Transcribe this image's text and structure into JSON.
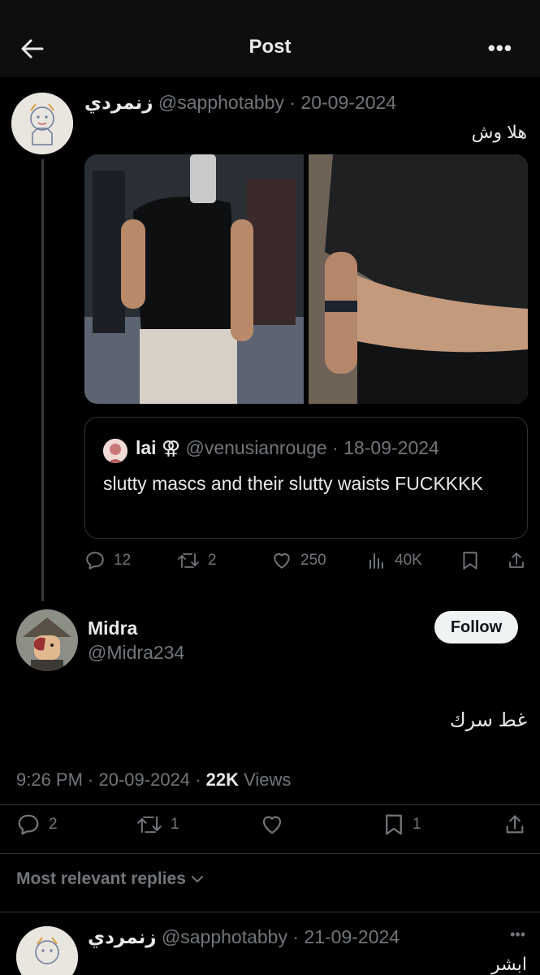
{
  "header": {
    "title": "Post"
  },
  "reply_to_post": {
    "author_name": "زنمردي",
    "handle": "@sapphotabby",
    "date": "20-09-2024",
    "text": "هلا وش",
    "quote": {
      "author_name": "lai ⚢",
      "handle": "@venusianrouge",
      "date": "18-09-2024",
      "text": "slutty mascs and their slutty waists FUCKKKK"
    },
    "actions": {
      "replies": "12",
      "reposts": "2",
      "likes": "250",
      "views": "40K"
    }
  },
  "main_post": {
    "author_name": "Midra",
    "handle": "@Midra234",
    "follow_label": "Follow",
    "text": "غط سرك",
    "time": "9:26 PM",
    "date": "20-09-2024",
    "views_count": "22K",
    "views_label": "Views",
    "actions": {
      "replies": "2",
      "reposts": "1",
      "bookmarks": "1"
    }
  },
  "replies_filter": {
    "label": "Most relevant replies"
  },
  "reply": {
    "author_name": "زنمردي",
    "handle": "@sapphotabby",
    "date": "21-09-2024",
    "text": "ابشر"
  },
  "colors": {
    "background": "#000000",
    "text": "#e7e9ea",
    "muted": "#71767b",
    "border": "#2f3336"
  }
}
